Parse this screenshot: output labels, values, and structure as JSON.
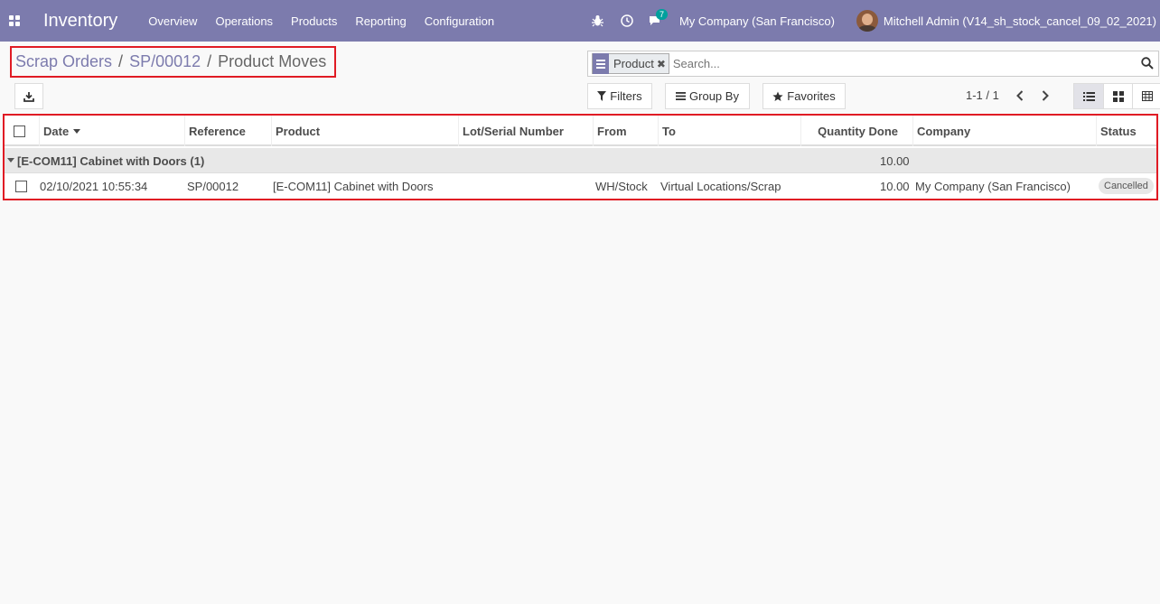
{
  "nav": {
    "brand": "Inventory",
    "menu": [
      "Overview",
      "Operations",
      "Products",
      "Reporting",
      "Configuration"
    ],
    "messages_count": "7",
    "company": "My Company (San Francisco)",
    "user": "Mitchell Admin (V14_sh_stock_cancel_09_02_2021)"
  },
  "breadcrumb": {
    "items": [
      "Scrap Orders",
      "SP/00012"
    ],
    "active": "Product Moves",
    "separator": "/"
  },
  "search": {
    "facet_label": "Product",
    "placeholder": "Search..."
  },
  "toolbar": {
    "filters": "Filters",
    "group_by": "Group By",
    "favorites": "Favorites",
    "pager": "1-1 / 1"
  },
  "table": {
    "columns": [
      "Date",
      "Reference",
      "Product",
      "Lot/Serial Number",
      "From",
      "To",
      "Quantity Done",
      "Company",
      "Status"
    ],
    "group": {
      "label": "[E-COM11] Cabinet with Doors (1)",
      "total": "10.00"
    },
    "rows": [
      {
        "date": "02/10/2021 10:55:34",
        "reference": "SP/00012",
        "product": "[E-COM11] Cabinet with Doors",
        "lot": "",
        "from": "WH/Stock",
        "to": "Virtual Locations/Scrap",
        "qty": "10.00",
        "company": "My Company (San Francisco)",
        "status": "Cancelled"
      }
    ]
  },
  "colors": {
    "navbar": "#7c7bad",
    "highlight_border": "#e01b24",
    "link": "#7c7bad"
  }
}
